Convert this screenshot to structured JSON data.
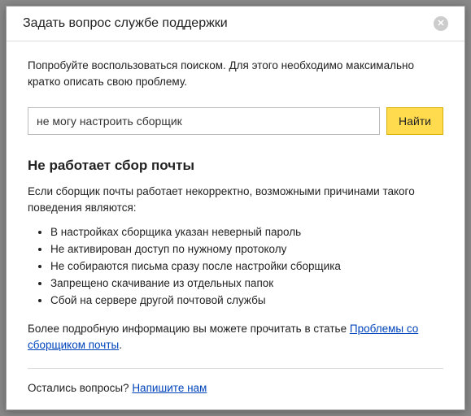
{
  "header": {
    "title": "Задать вопрос службе поддержки"
  },
  "intro": "Попробуйте воспользоваться поиском. Для этого необходимо максимально кратко описать свою проблему.",
  "search": {
    "value": "не могу настроить сборщик",
    "button": "Найти"
  },
  "section": {
    "title": "Не работает сбор почты",
    "lead": "Если сборщик почты работает некорректно, возможными причинами такого поведения являются:",
    "reasons": [
      "В настройках сборщика указан неверный пароль",
      "Не активирован доступ по нужному протоколу",
      "Не собираются письма сразу после настройки сборщика",
      "Запрещено скачивание из отдельных папок",
      "Сбой на сервере другой почтовой службы"
    ],
    "more_prefix": "Более подробную информацию вы можете прочитать в статье ",
    "more_link": "Проблемы со сборщиком почты",
    "more_suffix": "."
  },
  "footer": {
    "prefix": "Остались вопросы? ",
    "link": "Напишите нам"
  }
}
